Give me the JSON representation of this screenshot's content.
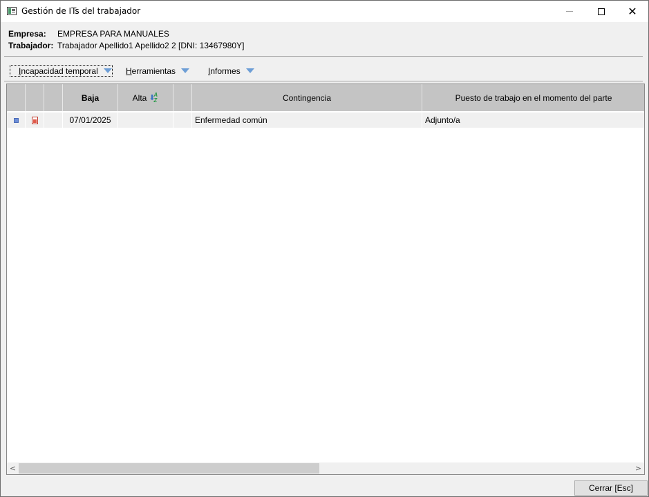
{
  "window": {
    "title": "Gestión de ITs del trabajador",
    "minimize_icon": "minimize-icon",
    "maximize_icon": "maximize-icon",
    "close_icon": "close-icon",
    "close_glyph": "✕"
  },
  "info": {
    "empresa_label": "Empresa:",
    "empresa_value": "EMPRESA PARA MANUALES",
    "trabajador_label": "Trabajador:",
    "trabajador_value": "Trabajador Apellido1 Apellido2 2  [DNI: 13467980Y]"
  },
  "toolbar": {
    "incapacidad_first": "I",
    "incapacidad_rest": "ncapacidad temporal",
    "herramientas_first": "H",
    "herramientas_rest": "erramientas",
    "informes_first": "I",
    "informes_rest": "nformes",
    "accent_color": "#6d9ed6"
  },
  "grid": {
    "headers": {
      "baja": "Baja",
      "alta": "Alta",
      "contingencia": "Contingencia",
      "puesto": "Puesto de trabajo en el momento del parte"
    },
    "sort_icon_text": "A Z",
    "sort_arrow": "⬇",
    "rows": [
      {
        "baja": "07/01/2025",
        "alta": "",
        "contingencia": "Enfermedad común",
        "puesto": "Adjunto/a"
      }
    ]
  },
  "scrollbar": {
    "left_arrow": "<",
    "right_arrow": ">"
  },
  "footer": {
    "close_button": "Cerrar  [Esc]"
  }
}
